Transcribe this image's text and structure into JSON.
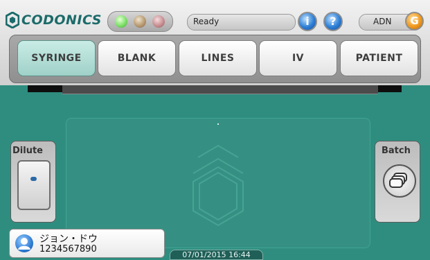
{
  "header": {
    "logo_text": "CODONICS",
    "status_text": "Ready",
    "user": "ADN",
    "user_badge_glyph": "G",
    "info_button_glyph": "i",
    "help_button_glyph": "?"
  },
  "status_leds": [
    {
      "name": "ready",
      "color": "#7fe06a"
    },
    {
      "name": "warning",
      "color": "#b89b72"
    },
    {
      "name": "error",
      "color": "#c98f92"
    }
  ],
  "tabs": [
    {
      "label": "SYRINGE",
      "active": true
    },
    {
      "label": "BLANK",
      "active": false
    },
    {
      "label": "LINES",
      "active": false
    },
    {
      "label": "IV",
      "active": false
    },
    {
      "label": "PATIENT",
      "active": false
    }
  ],
  "side_controls": {
    "left_label": "Dilute",
    "right_label": "Batch"
  },
  "patient": {
    "name": "ジョン・ドウ",
    "id": "1234567890"
  },
  "footer": {
    "datetime": "07/01/2015 16:44"
  },
  "colors": {
    "background": "#2f8d7f",
    "accent_teal": "#1c6b6a",
    "active_tab": "#b4e0d8"
  },
  "icons": {
    "logo": "codonics-hexagon-icon",
    "info": "info-icon",
    "help": "help-icon",
    "batch": "stacked-labels-icon",
    "patient": "person-icon"
  }
}
